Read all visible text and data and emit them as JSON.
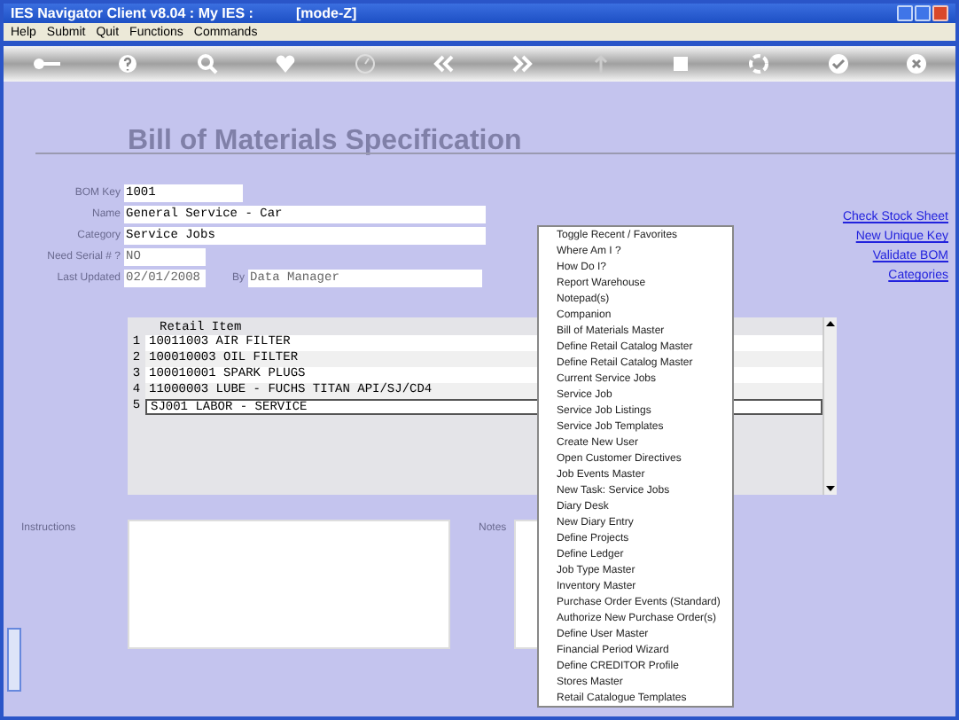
{
  "window": {
    "title": "IES Navigator Client v8.04 : My IES :",
    "mode": "[mode-Z]"
  },
  "menu_bar": [
    "Help",
    "Submit",
    "Quit",
    "Functions",
    "Commands"
  ],
  "page_title": "Bill of Materials Specification",
  "fields": [
    {
      "label": "BOM Key",
      "value": "1001",
      "readonly": false
    },
    {
      "label": "Name",
      "value": "General Service - Car",
      "readonly": false
    },
    {
      "label": "Category",
      "value": "Service Jobs",
      "readonly": false
    },
    {
      "label": "Need Serial # ?",
      "value": "NO",
      "readonly": true
    },
    {
      "label": "Last Updated",
      "value": "02/01/2008",
      "readonly": true
    }
  ],
  "by": {
    "label": "By",
    "value": "Data Manager",
    "readonly": true
  },
  "links": [
    "Check Stock Sheet",
    "New Unique Key",
    "Validate BOM",
    "Categories"
  ],
  "table": {
    "columns": [
      "Retail Item"
    ],
    "rows": [
      {
        "number": "1",
        "item": "10011003 AIR FILTER",
        "selected": false
      },
      {
        "number": "2",
        "item": "100010003 OIL FILTER",
        "selected": false
      },
      {
        "number": "3",
        "item": "100010001 SPARK PLUGS",
        "selected": false
      },
      {
        "number": "4",
        "item": "11000003 LUBE - FUCHS TITAN API/SJ/CD4",
        "selected": false
      },
      {
        "number": "5",
        "item": "SJ001 LABOR - SERVICE",
        "selected": true
      }
    ]
  },
  "instructions": {
    "label": "Instructions"
  },
  "notes": {
    "label": "Notes"
  },
  "context_menu": [
    "Toggle Recent / Favorites",
    "Where Am I ?",
    "How Do I?",
    "Report Warehouse",
    "Notepad(s)",
    "Companion",
    "Bill of Materials Master",
    "Define Retail Catalog Master",
    "Define Retail Catalog Master",
    "Current Service Jobs",
    "Service Job",
    "Service Job Listings",
    "Service Job Templates",
    "Create New User",
    "Open Customer Directives",
    "Job Events Master",
    "New Task: Service Jobs",
    "Diary Desk",
    "New Diary Entry",
    "Define Projects",
    "Define Ledger",
    "Job Type Master",
    "Inventory Master",
    "Purchase Order Events (Standard)",
    "Authorize New Purchase Order(s)",
    "Define User Master",
    "Financial Period Wizard",
    "Define CREDITOR Profile",
    "Stores Master",
    "Retail Catalogue Templates"
  ]
}
